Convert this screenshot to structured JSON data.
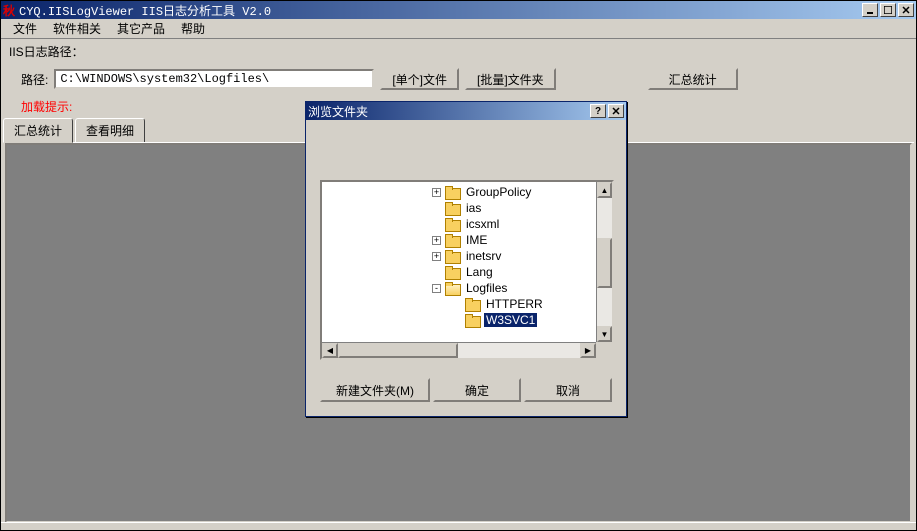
{
  "window": {
    "title": "CYQ.IISLogViewer IIS日志分析工具 V2.0"
  },
  "menu": {
    "file": "文件",
    "software": "软件相关",
    "other_products": "其它产品",
    "help": "帮助"
  },
  "section_label": "IIS日志路径：",
  "path": {
    "label": "路径:",
    "value": "C:\\WINDOWS\\system32\\Logfiles\\",
    "btn_single": "[单个]文件",
    "btn_batch": "[批量]文件夹",
    "btn_summary": "汇总统计"
  },
  "warn": "加载提示:",
  "tabs": {
    "summary": "汇总统计",
    "detail": "查看明细"
  },
  "dialog": {
    "title": "浏览文件夹",
    "tree": [
      {
        "indent": 110,
        "expander": "+",
        "label": "GroupPolicy",
        "selected": false
      },
      {
        "indent": 110,
        "expander": "",
        "label": "ias",
        "selected": false
      },
      {
        "indent": 110,
        "expander": "",
        "label": "icsxml",
        "selected": false
      },
      {
        "indent": 110,
        "expander": "+",
        "label": "IME",
        "selected": false
      },
      {
        "indent": 110,
        "expander": "+",
        "label": "inetsrv",
        "selected": false
      },
      {
        "indent": 110,
        "expander": "",
        "label": "Lang",
        "selected": false
      },
      {
        "indent": 110,
        "expander": "-",
        "label": "Logfiles",
        "selected": false,
        "open": true
      },
      {
        "indent": 130,
        "expander": "",
        "label": "HTTPERR",
        "selected": false
      },
      {
        "indent": 130,
        "expander": "",
        "label": "W3SVC1",
        "selected": true
      }
    ],
    "btn_new_folder": "新建文件夹(M)",
    "btn_ok": "确定",
    "btn_cancel": "取消"
  }
}
